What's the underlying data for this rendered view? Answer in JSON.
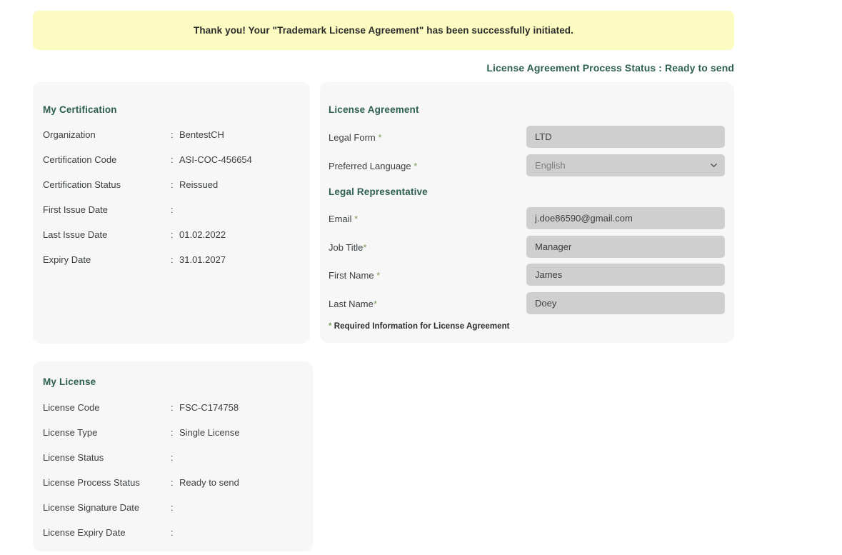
{
  "banner": {
    "message": "Thank you! Your \"Trademark License Agreement\" has been successfully initiated."
  },
  "process_status": {
    "text": "License Agreement Process Status : Ready to send"
  },
  "certification_card": {
    "title": "My Certification",
    "rows": [
      {
        "label": "Organization",
        "separator": ":",
        "value": "BentestCH"
      },
      {
        "label": "Certification Code",
        "separator": ":",
        "value": "ASI-COC-456654"
      },
      {
        "label": "Certification Status",
        "separator": ":",
        "value": "Reissued"
      },
      {
        "label": "First Issue Date",
        "separator": ":",
        "value": ""
      },
      {
        "label": "Last Issue Date",
        "separator": ":",
        "value": "01.02.2022"
      },
      {
        "label": "Expiry Date",
        "separator": ":",
        "value": "31.01.2027"
      }
    ]
  },
  "license_card": {
    "title": "My License",
    "rows": [
      {
        "label": "License Code",
        "separator": ":",
        "value": "FSC-C174758"
      },
      {
        "label": "License Type",
        "separator": ":",
        "value": "Single License"
      },
      {
        "label": "License Status",
        "separator": ":",
        "value": ""
      },
      {
        "label": "License Process Status",
        "separator": ":",
        "value": "Ready to send"
      },
      {
        "label": "License Signature Date",
        "separator": ":",
        "value": ""
      },
      {
        "label": "License Expiry Date",
        "separator": ":",
        "value": ""
      }
    ]
  },
  "agreement_card": {
    "title": "License Agreement",
    "subsection_title": "Legal Representative",
    "fields": [
      {
        "label": "Legal Form ",
        "required": "*",
        "value": "LTD",
        "placeholder": ""
      },
      {
        "label": "Job Title",
        "required": "*",
        "value": "Manager",
        "placeholder": ""
      },
      {
        "label": "Email ",
        "required": "*",
        "value": "j.doe86590@gmail.com",
        "placeholder": ""
      },
      {
        "label": "First Name ",
        "required": "*",
        "value": "James",
        "placeholder": ""
      },
      {
        "label": "Last Name",
        "required": "*",
        "value": "Doey",
        "placeholder": ""
      }
    ],
    "language_field": {
      "label": "Preferred Language ",
      "required": "*",
      "selected": "English",
      "options": [
        "English"
      ],
      "icon": "chevron-down-icon"
    },
    "footnote": {
      "star": "*",
      "text": " Required Information for License Agreement"
    }
  },
  "colors": {
    "banner_bg": "#fbfbc2",
    "card_bg": "#f7f7f7",
    "accent_green": "#2d5f52",
    "field_bg": "#cfcfcf",
    "required_star": "#7d9c5c",
    "text": "#3c4043"
  }
}
